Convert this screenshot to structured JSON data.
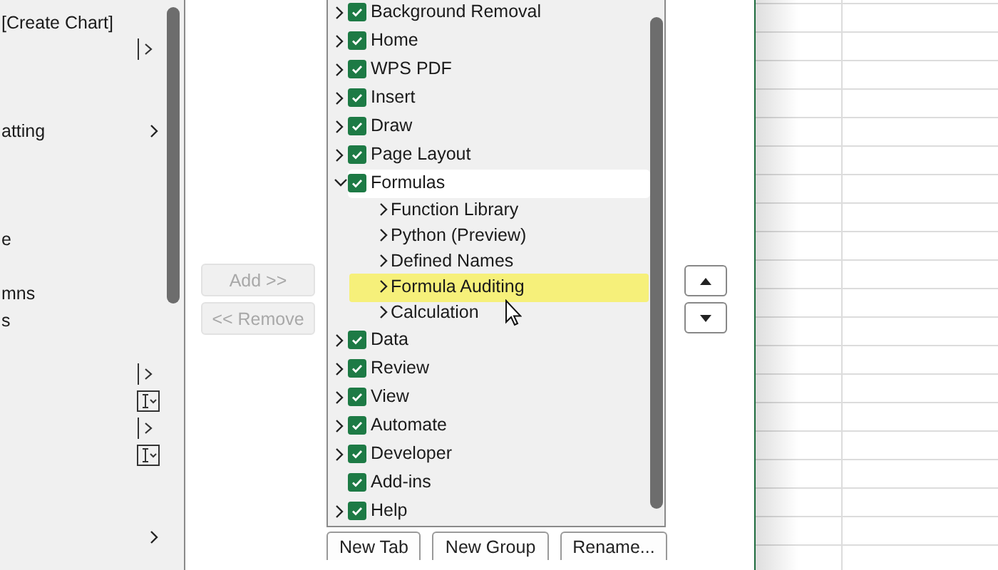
{
  "left_list": {
    "rows": [
      {
        "kind": "text",
        "text": "[Create Chart]"
      },
      {
        "kind": "split-expand"
      },
      {
        "kind": "blank"
      },
      {
        "kind": "blank"
      },
      {
        "kind": "text-expand",
        "text": "atting"
      },
      {
        "kind": "blank"
      },
      {
        "kind": "blank"
      },
      {
        "kind": "blank"
      },
      {
        "kind": "text",
        "text": "e"
      },
      {
        "kind": "blank"
      },
      {
        "kind": "text",
        "text": "mns"
      },
      {
        "kind": "text",
        "text": "s"
      },
      {
        "kind": "blank"
      },
      {
        "kind": "split-expand"
      },
      {
        "kind": "dropdown"
      },
      {
        "kind": "split-expand"
      },
      {
        "kind": "dropdown"
      },
      {
        "kind": "blank"
      },
      {
        "kind": "blank"
      },
      {
        "kind": "expand"
      }
    ]
  },
  "move_buttons": [
    {
      "label": "Add >>",
      "disabled": true
    },
    {
      "label": "<< Remove",
      "disabled": true
    }
  ],
  "ribbon_tabs": [
    {
      "label": "Background Removal",
      "checked": true,
      "expandable": true,
      "expanded": false,
      "selected": false
    },
    {
      "label": "Home",
      "checked": true,
      "expandable": true,
      "expanded": false,
      "selected": false
    },
    {
      "label": "WPS PDF",
      "checked": true,
      "expandable": true,
      "expanded": false,
      "selected": false
    },
    {
      "label": "Insert",
      "checked": true,
      "expandable": true,
      "expanded": false,
      "selected": false
    },
    {
      "label": "Draw",
      "checked": true,
      "expandable": true,
      "expanded": false,
      "selected": false
    },
    {
      "label": "Page Layout",
      "checked": true,
      "expandable": true,
      "expanded": false,
      "selected": false
    },
    {
      "label": "Formulas",
      "checked": true,
      "expandable": true,
      "expanded": true,
      "selected": true,
      "children": [
        {
          "label": "Function Library",
          "highlighted": false
        },
        {
          "label": "Python (Preview)",
          "highlighted": false
        },
        {
          "label": "Defined Names",
          "highlighted": false
        },
        {
          "label": "Formula Auditing",
          "highlighted": true
        },
        {
          "label": "Calculation",
          "highlighted": false
        }
      ]
    },
    {
      "label": "Data",
      "checked": true,
      "expandable": true,
      "expanded": false,
      "selected": false
    },
    {
      "label": "Review",
      "checked": true,
      "expandable": true,
      "expanded": false,
      "selected": false
    },
    {
      "label": "View",
      "checked": true,
      "expandable": true,
      "expanded": false,
      "selected": false
    },
    {
      "label": "Automate",
      "checked": true,
      "expandable": true,
      "expanded": false,
      "selected": false
    },
    {
      "label": "Developer",
      "checked": true,
      "expandable": true,
      "expanded": false,
      "selected": false
    },
    {
      "label": "Add-ins",
      "checked": true,
      "expandable": false,
      "expanded": false,
      "selected": false
    },
    {
      "label": "Help",
      "checked": true,
      "expandable": true,
      "expanded": false,
      "selected": false
    }
  ],
  "bottom_buttons": [
    "New Tab",
    "New Group",
    "Rename..."
  ],
  "order_buttons": [
    {
      "kind": "up"
    },
    {
      "kind": "down"
    }
  ]
}
